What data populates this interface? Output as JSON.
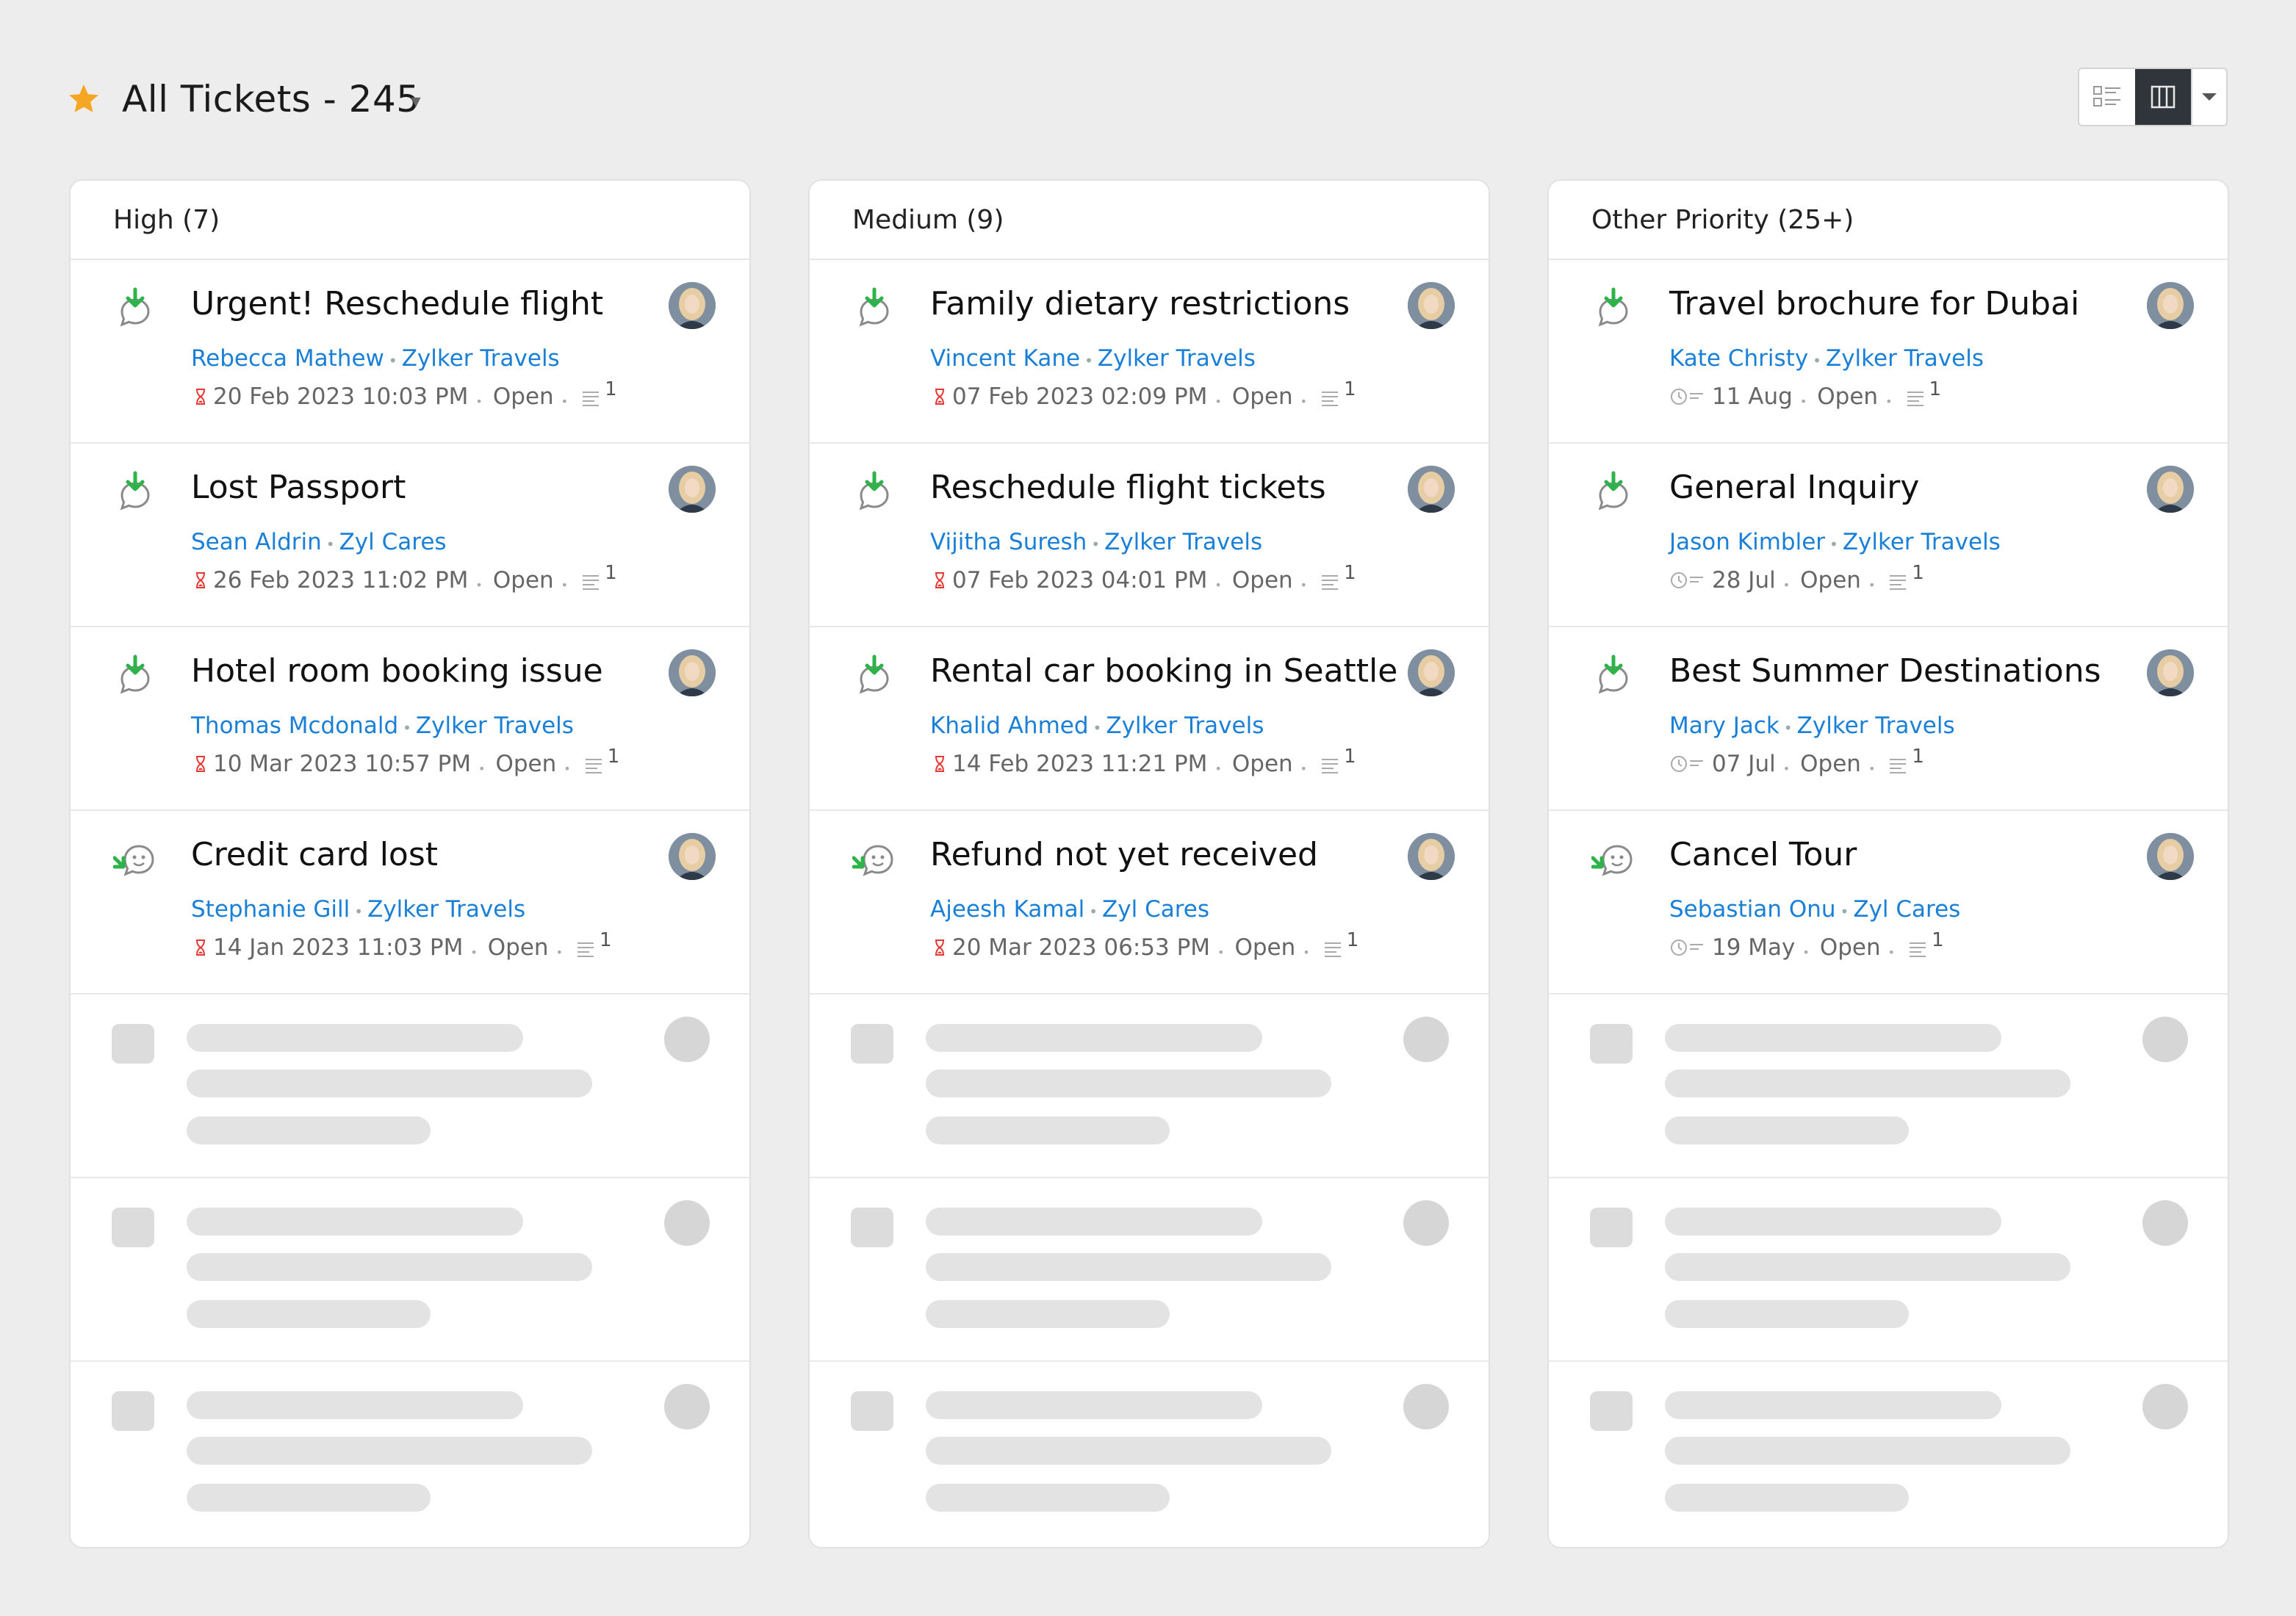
{
  "header": {
    "title": "All Tickets - 245",
    "star_color": "#f5a623"
  },
  "view_switch": {
    "icons": [
      "list-view-icon",
      "kanban-view-icon",
      "chevron-down-icon"
    ],
    "active": "kanban-view-icon"
  },
  "columns": [
    {
      "title": "High (7)",
      "cards": [
        {
          "subject": "Urgent! Reschedule flight",
          "contact": "Rebecca Mathew",
          "account": "Zylker Travels",
          "due": "20 Feb 2023 10:03 PM",
          "due_type": "overdue",
          "status": "Open",
          "threads": "1",
          "channel": "reply-icon"
        },
        {
          "subject": "Lost Passport",
          "contact": "Sean Aldrin",
          "account": "Zyl Cares",
          "due": "26  Feb 2023 11:02 PM",
          "due_type": "overdue",
          "status": "Open",
          "threads": "1",
          "channel": "reply-icon"
        },
        {
          "subject": "Hotel room booking issue",
          "contact": "Thomas Mcdonald",
          "account": "Zylker Travels",
          "due": "10 Mar 2023 10:57 PM",
          "due_type": "overdue",
          "status": "Open",
          "threads": "1",
          "channel": "reply-icon"
        },
        {
          "subject": "Credit card lost",
          "contact": "Stephanie Gill",
          "account": "Zylker Travels",
          "due": "14 Jan 2023 11:03 PM",
          "due_type": "overdue",
          "status": "Open",
          "threads": "1",
          "channel": "chat-icon"
        }
      ]
    },
    {
      "title": "Medium (9)",
      "cards": [
        {
          "subject": "Family dietary restrictions",
          "contact": "Vincent Kane",
          "account": "Zylker Travels",
          "due": "07 Feb 2023 02:09 PM",
          "due_type": "overdue",
          "status": "Open",
          "threads": "1",
          "channel": "reply-icon"
        },
        {
          "subject": "Reschedule flight tickets",
          "contact": "Vijitha Suresh",
          "account": "Zylker Travels",
          "due": "07 Feb 2023 04:01 PM",
          "due_type": "overdue",
          "status": "Open",
          "threads": "1",
          "channel": "reply-icon"
        },
        {
          "subject": "Rental car booking in Seattle",
          "contact": "Khalid Ahmed",
          "account": "Zylker Travels",
          "due": "14 Feb 2023 11:21 PM",
          "due_type": "overdue",
          "status": "Open",
          "threads": "1",
          "channel": "reply-icon"
        },
        {
          "subject": "Refund not yet received",
          "contact": "Ajeesh Kamal",
          "account": "Zyl Cares",
          "due": "20 Mar 2023 06:53 PM",
          "due_type": "overdue",
          "status": "Open",
          "threads": "1",
          "channel": "chat-icon"
        }
      ]
    },
    {
      "title": "Other Priority (25+)",
      "cards": [
        {
          "subject": "Travel brochure for Dubai",
          "contact": "Kate Christy",
          "account": "Zylker Travels",
          "due": "11 Aug",
          "due_type": "date",
          "status": "Open",
          "threads": "1",
          "channel": "reply-icon"
        },
        {
          "subject": "General Inquiry",
          "contact": "Jason Kimbler",
          "account": "Zylker Travels",
          "due": "28 Jul",
          "due_type": "date",
          "status": "Open",
          "threads": "1",
          "channel": "reply-icon"
        },
        {
          "subject": "Best Summer Destinations",
          "contact": "Mary Jack",
          "account": "Zylker Travels",
          "due": "07 Jul",
          "due_type": "date",
          "status": "Open",
          "threads": "1",
          "channel": "reply-icon"
        },
        {
          "subject": "Cancel Tour",
          "contact": "Sebastian Onu",
          "account": "Zyl Cares",
          "due": "19 May",
          "due_type": "date",
          "status": "Open",
          "threads": "1",
          "channel": "chat-icon"
        }
      ]
    }
  ],
  "colors": {
    "link": "#1a7fd6",
    "overdue": "#e53935",
    "channel_green": "#2db34a"
  }
}
